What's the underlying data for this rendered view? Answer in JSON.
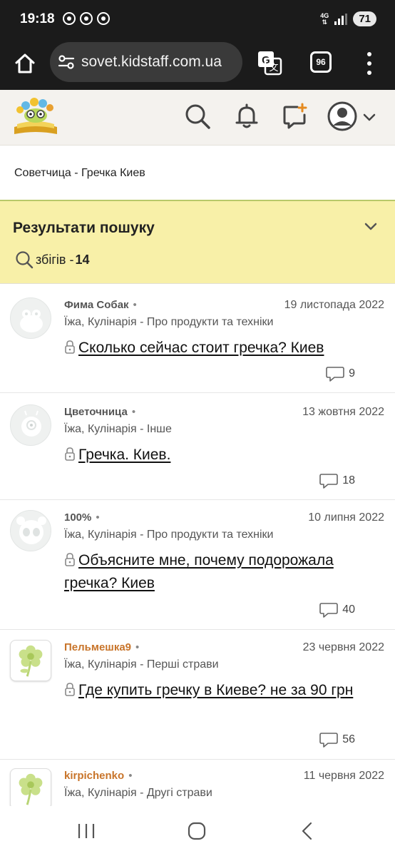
{
  "status_bar": {
    "time": "19:18",
    "network": "4G",
    "battery": "71"
  },
  "browser": {
    "url": "sovet.kidstaff.com.ua",
    "tabs_count": "96"
  },
  "site": {
    "icons": [
      "logo-icon",
      "search-icon",
      "bell-icon",
      "new-message-icon",
      "user-avatar-icon",
      "chevron-down-icon"
    ]
  },
  "breadcrumb": "Советчица - Гречка Киев",
  "results": {
    "title": "Результати пошуку",
    "count_label": "збігів - ",
    "count": "14"
  },
  "items": [
    {
      "author": "Фима Собак",
      "date": "19 листопада 2022",
      "category": "Їжа, Кулінарія - Про продукти та техніки",
      "title": "Сколько сейчас стоит гречка? Киев",
      "comments": "9"
    },
    {
      "author": "Цветочница",
      "date": "13 жовтня 2022",
      "category": "Їжа, Кулінарія - Інше",
      "title": "Гречка. Киев.",
      "comments": "18"
    },
    {
      "author": "100%",
      "date": "10 липня 2022",
      "category": "Їжа, Кулінарія - Про продукти та техніки",
      "title": "Объясните мне, почему подорожала гречка? Киев",
      "comments": "40"
    },
    {
      "author": "Пельмешка9",
      "date": "23 червня 2022",
      "category": "Їжа, Кулінарія - Перші страви",
      "title": "Где купить гречку в Киеве? не за 90 грн",
      "comments": "56"
    },
    {
      "author": "kirpichenko",
      "date": "11 червня 2022",
      "category": "Їжа, Кулінарія - Другі страви",
      "title": "",
      "comments": ""
    }
  ],
  "colors": {
    "results_bg": "#f8f0a8",
    "author_highlight": "#c8742a",
    "browser_bar": "#1b1b1b"
  }
}
